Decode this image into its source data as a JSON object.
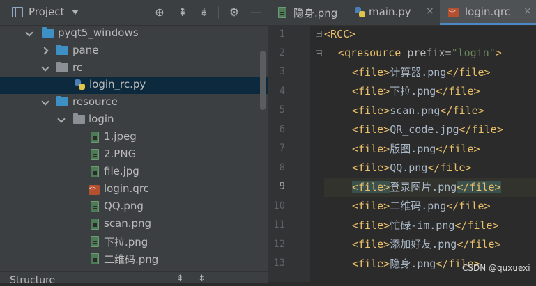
{
  "project_panel": {
    "title": "Project",
    "header_icons": [
      "target-icon",
      "expand-all-icon",
      "collapse-all-icon",
      "gear-icon",
      "hide-icon"
    ],
    "tree": [
      {
        "label": "pyqt5_windows",
        "type": "folder-blue",
        "expanded": true
      },
      {
        "label": "pane",
        "type": "folder-blue",
        "expanded": false
      },
      {
        "label": "rc",
        "type": "folder-grey",
        "expanded": true
      },
      {
        "label": "login_rc.py",
        "type": "python-file",
        "selected": true
      },
      {
        "label": "resource",
        "type": "folder-blue",
        "expanded": true
      },
      {
        "label": "login",
        "type": "folder-grey",
        "expanded": true
      },
      {
        "label": "1.jpeg",
        "type": "image-file"
      },
      {
        "label": "2.PNG",
        "type": "image-file"
      },
      {
        "label": "file.jpg",
        "type": "image-file"
      },
      {
        "label": "login.qrc",
        "type": "qrc-file"
      },
      {
        "label": "QQ.png",
        "type": "image-file"
      },
      {
        "label": "scan.png",
        "type": "image-file"
      },
      {
        "label": "下拉.png",
        "type": "image-file"
      },
      {
        "label": "二维码.png",
        "type": "image-file"
      }
    ],
    "structure_title": "Structure"
  },
  "editor": {
    "tabs": [
      {
        "label": "隐身.png",
        "icon": "image-file-icon",
        "active": false
      },
      {
        "label": "main.py",
        "icon": "python-file-icon",
        "active": false
      },
      {
        "label": "login.qrc",
        "icon": "qrc-file-icon",
        "active": true
      }
    ],
    "line_numbers": [
      "1",
      "2",
      "3",
      "4",
      "5",
      "6",
      "7",
      "8",
      "9",
      "10",
      "11",
      "12",
      "13"
    ],
    "current_line": "9",
    "lines": [
      {
        "open": "<RCC>",
        "text": "",
        "close": ""
      },
      {
        "open": "<qresource ",
        "attr": "prefix=",
        "value": "\"login\"",
        "close": ">"
      },
      {
        "open": "<file>",
        "text": "计算器.png",
        "close": "</file>"
      },
      {
        "open": "<file>",
        "text": "下拉.png",
        "close": "</file>"
      },
      {
        "open": "<file>",
        "text": "scan.png",
        "close": "</file>"
      },
      {
        "open": "<file>",
        "text": "QR_code.jpg",
        "close": "</file>"
      },
      {
        "open": "<file>",
        "text": "版图.png",
        "close": "</file>"
      },
      {
        "open": "<file>",
        "text": "QQ.png",
        "close": "</file>"
      },
      {
        "open": "<file>",
        "text": "登录图片.png",
        "close": "</file>"
      },
      {
        "open": "<file>",
        "text": "二维码.png",
        "close": "</file>"
      },
      {
        "open": "<file>",
        "text": "忙碌-im.png",
        "close": "</file>"
      },
      {
        "open": "<file>",
        "text": "添加好友.png",
        "close": "</file>"
      },
      {
        "open": "<file>",
        "text": "隐身.png",
        "close": "</file>"
      }
    ]
  },
  "watermark": "CSDN @quxuexi",
  "colors": {
    "tag": "#e8bf6a",
    "string": "#6a8759",
    "selection": "#0d293e",
    "accent": "#4a88c7"
  }
}
